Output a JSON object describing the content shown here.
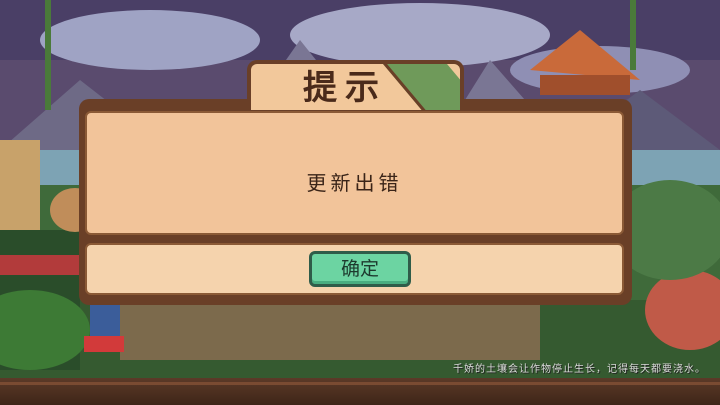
{
  "dialog": {
    "title": "提示",
    "message": "更新出错",
    "confirm_label": "确定"
  },
  "loading_tip": "千娇的土壤会让作物停止生长，记得每天都要浇水。",
  "colors": {
    "panel_border": "#6a3f27",
    "panel_fill": "#f2c49a",
    "button_fill": "#6cd4a2",
    "title_corner": "#6f9a5a"
  }
}
